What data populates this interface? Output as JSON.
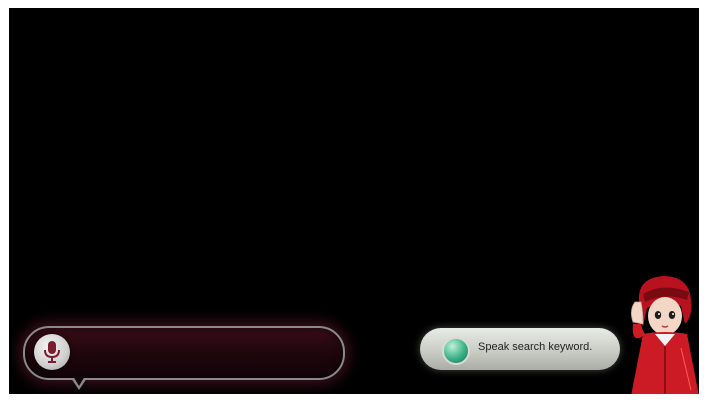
{
  "voice_input": {
    "value": "",
    "mic_icon": "microphone-icon"
  },
  "hint": {
    "text": "Speak search keyword.",
    "icon": "globe-search-icon"
  },
  "mascot": {
    "icon": "assistant-mascot"
  },
  "colors": {
    "screen": "#000000",
    "voice_bar": "#3a0d18",
    "hint_bubble": "#d7dbd3",
    "mascot_accent": "#d0202a"
  }
}
